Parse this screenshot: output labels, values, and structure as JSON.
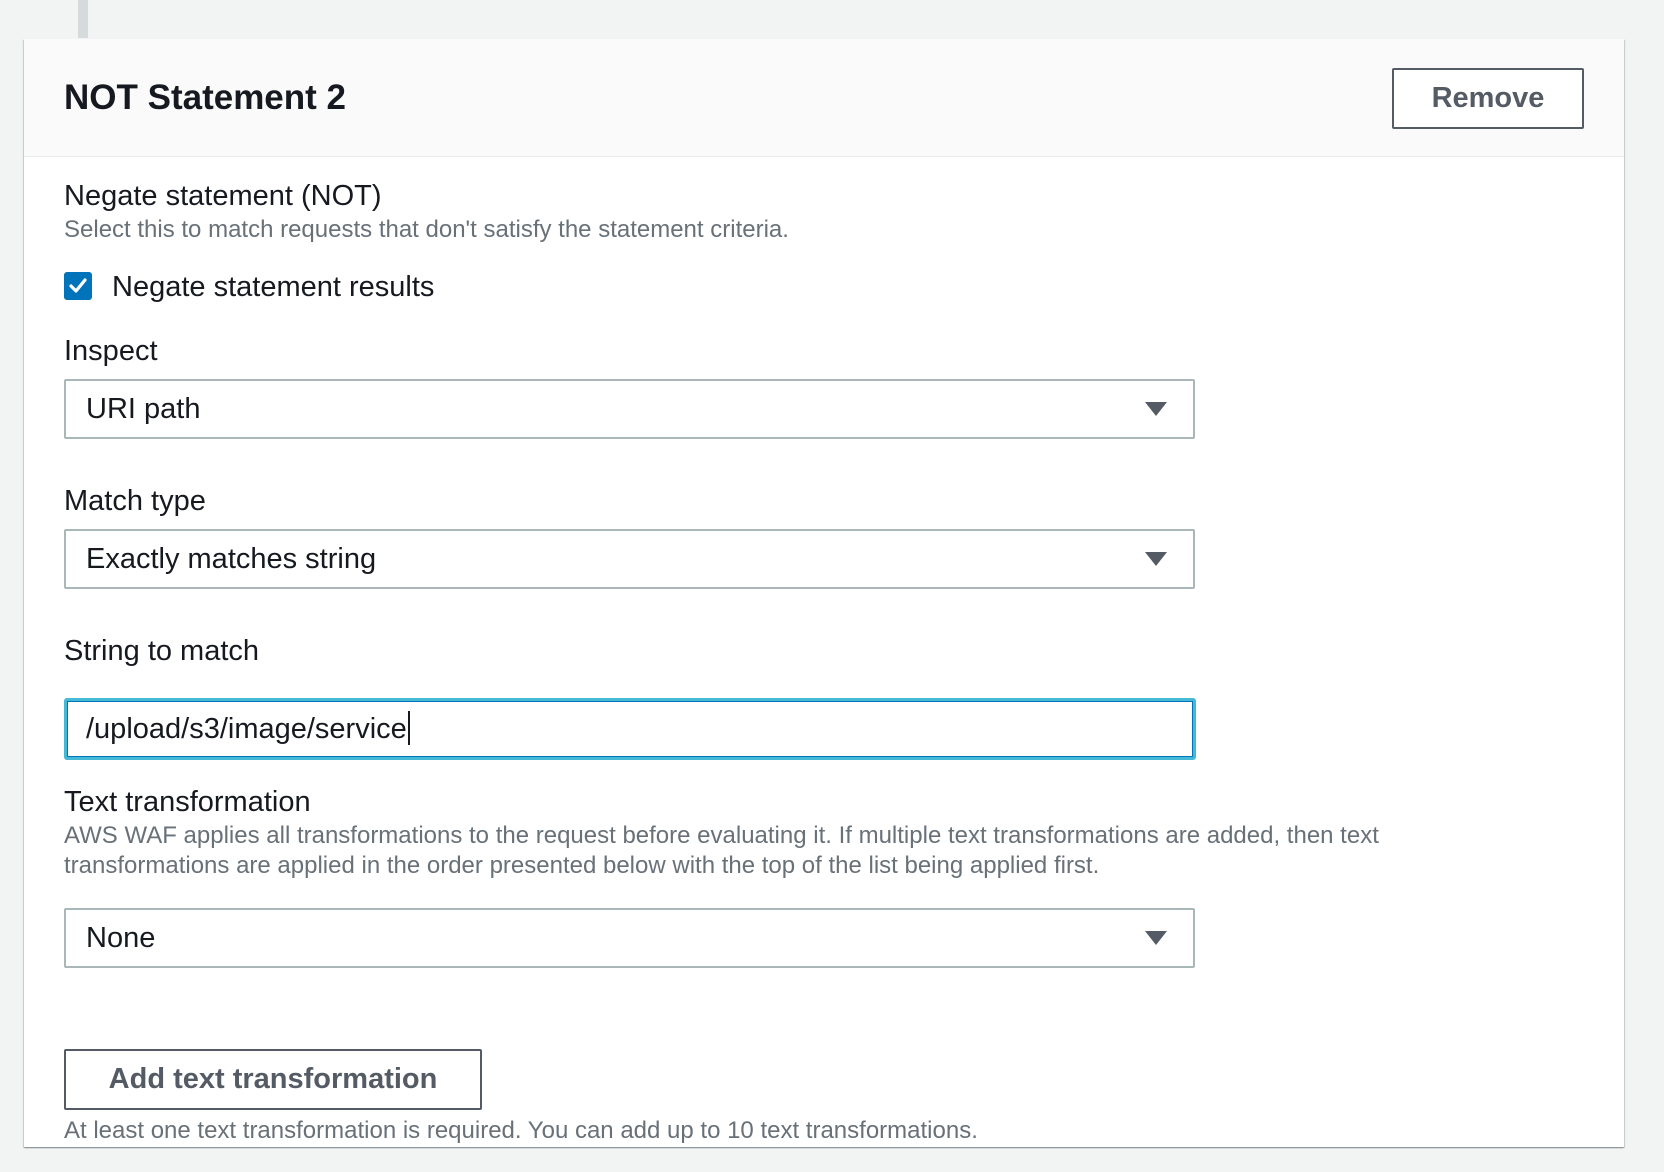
{
  "panel": {
    "title": "NOT Statement 2",
    "remove_label": "Remove"
  },
  "negate": {
    "label": "Negate statement (NOT)",
    "description": "Select this to match requests that don't satisfy the statement criteria.",
    "checkbox_label": "Negate statement results",
    "checked": true
  },
  "inspect": {
    "label": "Inspect",
    "selected": "URI path"
  },
  "match_type": {
    "label": "Match type",
    "selected": "Exactly matches string"
  },
  "string_to_match": {
    "label": "String to match",
    "value": "/upload/s3/image/service"
  },
  "text_transformation": {
    "label": "Text transformation",
    "description": "AWS WAF applies all transformations to the request before evaluating it. If multiple text transformations are added, then text transformations are applied in the order presented below with the top of the list being applied first.",
    "selected": "None",
    "add_label": "Add text transformation",
    "footnote": "At least one text transformation is required. You can add up to 10 text transformations."
  },
  "colors": {
    "checkbox": "#0073bb",
    "focus_border": "#44b9d6",
    "button_border": "#545b64"
  },
  "icons": {
    "checkbox": "checkmark-icon",
    "dropdown": "caret-down-icon"
  }
}
